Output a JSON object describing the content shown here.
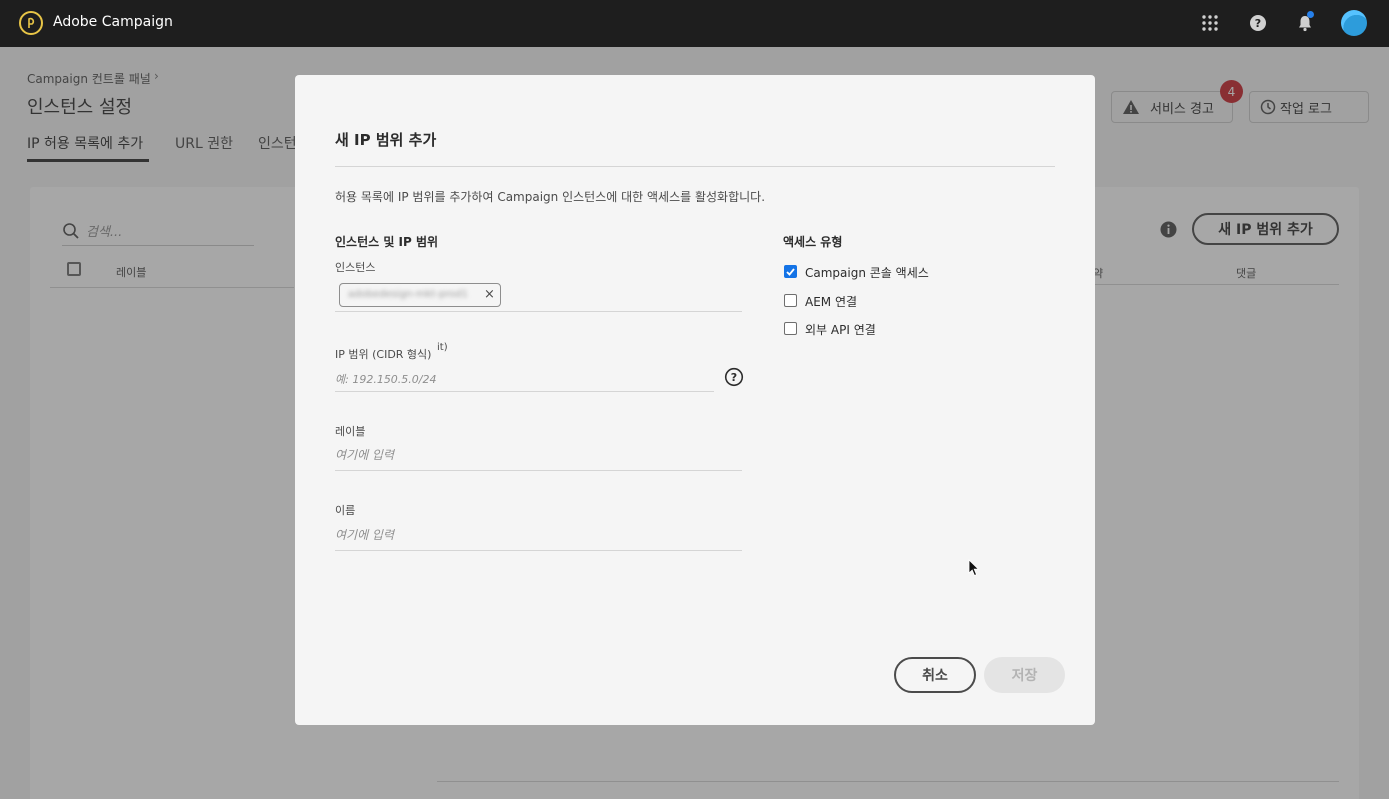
{
  "app": {
    "title": "Adobe Campaign"
  },
  "topbar": {
    "icons": [
      "apps-grid-icon",
      "help-icon",
      "bell-icon",
      "avatar"
    ]
  },
  "page": {
    "breadcrumb": "Campaign 컨트롤 패널",
    "title": "인스턴스 설정",
    "tabs": [
      {
        "label": "IP 허용 목록에 추가",
        "active": true
      },
      {
        "label": "URL 권한",
        "active": false
      },
      {
        "label": "인스턴",
        "active": false
      }
    ],
    "alerts_label": "서비스 경고",
    "alerts_count": "4",
    "joblog_label": "작업 로그",
    "search_placeholder": "검색...",
    "add_button": "새 IP 범위 추가",
    "columns": {
      "label": "레이블",
      "partial": "약",
      "comment": "댓글"
    }
  },
  "modal": {
    "title": "새 IP 범위 추가",
    "description": "허용 목록에 IP 범위를 추가하여 Campaign 인스턴스에 대한 액세스를 활성화합니다.",
    "left_section_title": "인스턴스 및 IP 범위",
    "instance_label": "인스턴스",
    "instance_tag": "adobedesign-mkt-prod1",
    "ip_label": "IP 범위 (CIDR 형식)",
    "ip_stray": "it)",
    "ip_placeholder": "예: 192.150.5.0/24",
    "label_label": "레이블",
    "label_placeholder": "여기에 입력",
    "name_label": "이름",
    "name_placeholder": "여기에 입력",
    "right_section_title": "액세스 유형",
    "access_types": [
      {
        "label": "Campaign 콘솔 액세스",
        "checked": true
      },
      {
        "label": "AEM 연결",
        "checked": false
      },
      {
        "label": "외부 API 연결",
        "checked": false
      }
    ],
    "cancel_label": "취소",
    "save_label": "저장"
  },
  "colors": {
    "accent": "#1473e6",
    "badge": "#c9252d",
    "topbar": "#1e1e1e"
  }
}
